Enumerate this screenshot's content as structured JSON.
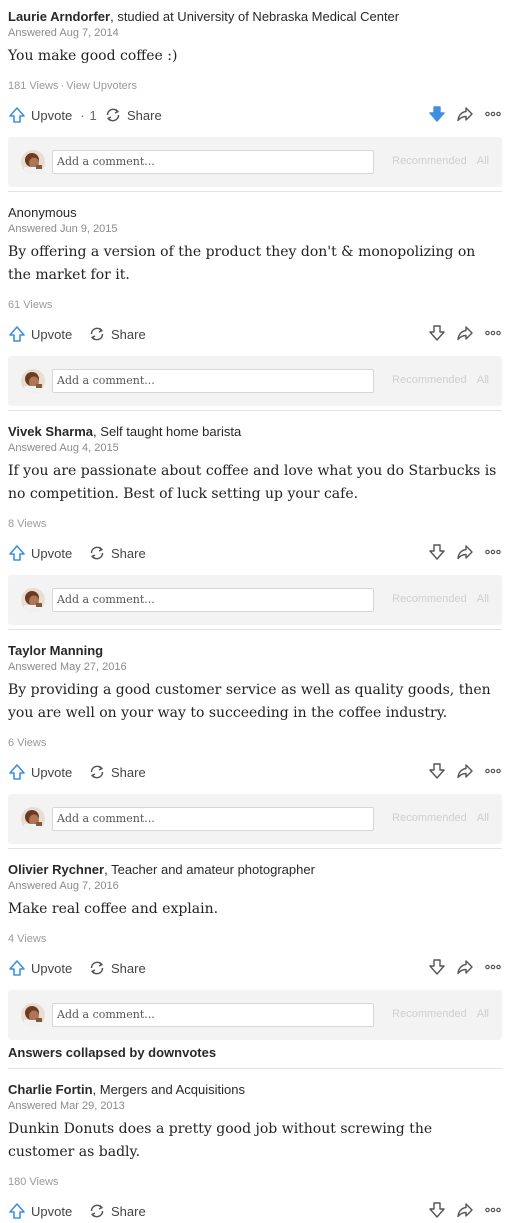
{
  "answers": [
    {
      "author": "Laurie Arndorfer",
      "credential": ", studied at University of Nebraska Medical Center",
      "answered": "Answered Aug 7, 2014",
      "body": "You make good coffee :)",
      "views": "181 Views",
      "view_sep": "·",
      "view_upvoters": "View Upvoters",
      "upvote_label": "Upvote",
      "upvote_sep": "·",
      "upvote_count": "1",
      "share_label": "Share",
      "downvoted": true,
      "comment_placeholder": "Add a comment...",
      "tab_recommended": "Recommended",
      "tab_all": "All"
    },
    {
      "author": "Anonymous",
      "credential": "",
      "answered": "Answered Jun 9, 2015",
      "body": "By offering a version of the product they don't & monopolizing on the market for it.",
      "views": "61 Views",
      "upvote_label": "Upvote",
      "share_label": "Share",
      "downvoted": false,
      "comment_placeholder": "Add a comment...",
      "tab_recommended": "Recommended",
      "tab_all": "All"
    },
    {
      "author": "Vivek Sharma",
      "credential": ", Self taught home barista",
      "answered": "Answered Aug 4, 2015",
      "body": "If you are passionate about coffee and love what you do Starbucks is no competition. Best of luck setting up your cafe.",
      "views": "8 Views",
      "upvote_label": "Upvote",
      "share_label": "Share",
      "downvoted": false,
      "comment_placeholder": "Add a comment...",
      "tab_recommended": "Recommended",
      "tab_all": "All"
    },
    {
      "author": "Taylor Manning",
      "credential": "",
      "answered": "Answered May 27, 2016",
      "body": "By providing a good customer service as well as quality goods, then you are well on your way to succeeding in the coffee industry.",
      "views": "6 Views",
      "upvote_label": "Upvote",
      "share_label": "Share",
      "downvoted": false,
      "comment_placeholder": "Add a comment...",
      "tab_recommended": "Recommended",
      "tab_all": "All"
    },
    {
      "author": "Olivier Rychner",
      "credential": ", Teacher and amateur photographer",
      "answered": "Answered Aug 7, 2016",
      "body": "Make real coffee and explain.",
      "views": "4 Views",
      "upvote_label": "Upvote",
      "share_label": "Share",
      "downvoted": false,
      "comment_placeholder": "Add a comment...",
      "tab_recommended": "Recommended",
      "tab_all": "All"
    },
    {
      "author": "Charlie Fortin",
      "credential": ", Mergers and Acquisitions",
      "answered": "Answered Mar 29, 2013",
      "body": "Dunkin Donuts does a pretty good job without screwing the customer as badly.",
      "views": "180 Views",
      "upvote_label": "Upvote",
      "share_label": "Share",
      "downvoted": false
    }
  ],
  "collapsed_header": "Answers collapsed by downvotes",
  "colors": {
    "accent_blue": "#3e8fe0",
    "downvote_active": "#3e8fe0",
    "icon_gray": "#555555",
    "comment_bg": "#f3f3f3"
  },
  "icons": [
    "upvote-arrow-icon",
    "share-icon",
    "downvote-arrow-icon",
    "forward-icon",
    "more-dots-icon"
  ]
}
